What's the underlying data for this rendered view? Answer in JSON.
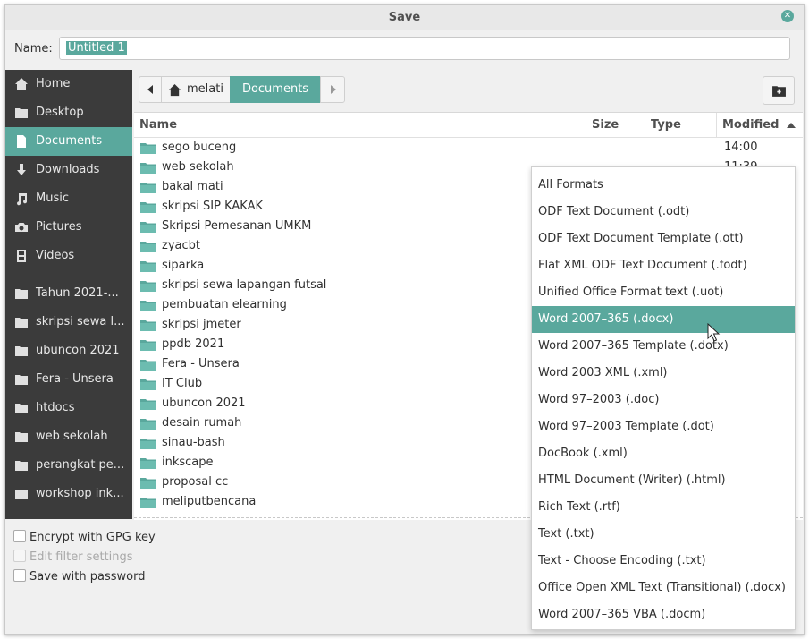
{
  "window": {
    "title": "Save"
  },
  "name_field": {
    "label": "Name:",
    "value": "Untitled 1"
  },
  "sidebar": {
    "places": [
      {
        "label": "Home",
        "icon": "home-icon",
        "active": false
      },
      {
        "label": "Desktop",
        "icon": "desktop-folder-icon",
        "active": false
      },
      {
        "label": "Documents",
        "icon": "document-icon",
        "active": true
      },
      {
        "label": "Downloads",
        "icon": "download-icon",
        "active": false
      },
      {
        "label": "Music",
        "icon": "music-icon",
        "active": false
      },
      {
        "label": "Pictures",
        "icon": "camera-icon",
        "active": false
      },
      {
        "label": "Videos",
        "icon": "film-icon",
        "active": false
      }
    ],
    "bookmarks": [
      {
        "label": "Tahun 2021-..."
      },
      {
        "label": "skripsi sewa l..."
      },
      {
        "label": "ubuncon 2021"
      },
      {
        "label": "Fera - Unsera"
      },
      {
        "label": "htdocs"
      },
      {
        "label": "web sekolah"
      },
      {
        "label": "perangkat pe..."
      },
      {
        "label": "workshop ink..."
      }
    ]
  },
  "pathbar": {
    "home_label": "melati",
    "current_label": "Documents"
  },
  "columns": {
    "name": "Name",
    "size": "Size",
    "type": "Type",
    "modified": "Modified"
  },
  "files": [
    {
      "name": "sego buceng",
      "modified": "14:00"
    },
    {
      "name": "web sekolah",
      "modified": "11:39"
    },
    {
      "name": "bakal mati",
      "modified": ""
    },
    {
      "name": "skripsi SIP KAKAK",
      "modified": ""
    },
    {
      "name": "Skripsi Pemesanan UMKM",
      "modified": ""
    },
    {
      "name": "zyacbt",
      "modified": ""
    },
    {
      "name": "siparka",
      "modified": ""
    },
    {
      "name": "skripsi sewa lapangan futsal",
      "modified": ""
    },
    {
      "name": "pembuatan elearning",
      "modified": ""
    },
    {
      "name": "skripsi jmeter",
      "modified": ""
    },
    {
      "name": "ppdb 2021",
      "modified": ""
    },
    {
      "name": "Fera - Unsera",
      "modified": ""
    },
    {
      "name": "IT Club",
      "modified": ""
    },
    {
      "name": "ubuncon 2021",
      "modified": ""
    },
    {
      "name": "desain rumah",
      "modified": ""
    },
    {
      "name": "sinau-bash",
      "modified": ""
    },
    {
      "name": "inkscape",
      "modified": ""
    },
    {
      "name": "proposal cc",
      "modified": ""
    },
    {
      "name": "meliputbencana",
      "modified": ""
    }
  ],
  "options": [
    {
      "label": "Encrypt with GPG key",
      "disabled": false
    },
    {
      "label": "Edit filter settings",
      "disabled": true
    },
    {
      "label": "Save with password",
      "disabled": false
    }
  ],
  "file_type_dropdown": {
    "selected": "Word 2007–365 (.docx)",
    "items": [
      "All Formats",
      "ODF Text Document (.odt)",
      "ODF Text Document Template (.ott)",
      "Flat XML ODF Text Document (.fodt)",
      "Unified Office Format text (.uot)",
      "Word 2007–365 (.docx)",
      "Word 2007–365 Template (.dotx)",
      "Word 2003 XML (.xml)",
      "Word 97–2003 (.doc)",
      "Word 97–2003 Template (.dot)",
      "DocBook (.xml)",
      "HTML Document (Writer) (.html)",
      "Rich Text (.rtf)",
      "Text (.txt)",
      "Text - Choose Encoding (.txt)",
      "Office Open XML Text (Transitional) (.docx)",
      "Word 2007–365 VBA (.docm)"
    ]
  },
  "colors": {
    "accent": "#5aa89d",
    "sidebar_bg": "#3b3b3b",
    "folder": "#5aa89d"
  }
}
